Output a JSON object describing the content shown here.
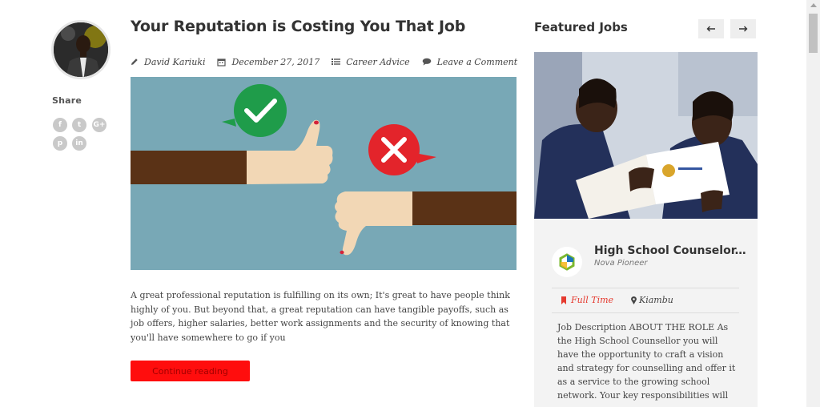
{
  "author_column": {
    "share_label": "Share",
    "social_icons": [
      {
        "name": "facebook-icon",
        "glyph": "f"
      },
      {
        "name": "twitter-icon",
        "glyph": "t"
      },
      {
        "name": "google-plus-icon",
        "glyph": "G+"
      },
      {
        "name": "pinterest-icon",
        "glyph": "p"
      },
      {
        "name": "linkedin-icon",
        "glyph": "in"
      }
    ]
  },
  "post": {
    "title": "Your Reputation is Costing You That Job",
    "author": "David Kariuki",
    "date": "December 27, 2017",
    "category": "Career Advice",
    "comments": "Leave a Comment",
    "excerpt": "A great professional reputation is fulfilling on its own; It's great to have people think highly of you. But beyond that, a great reputation can have tangible payoffs, such as job offers, higher salaries, better work assignments and the security of knowing that you'll have somewhere to go if you",
    "cta_label": "Continue reading"
  },
  "sidebar": {
    "title": "Featured Jobs",
    "prev_label": "←",
    "next_label": "→",
    "job": {
      "title": "High School Counselor...",
      "company": "Nova Pioneer",
      "type": "Full Time",
      "location": "Kiambu",
      "description": "Job Description ABOUT THE ROLE As the High School Counsellor you will have the opportunity to craft a vision and strategy for counselling and offer it as a service to the growing school network. Your key responsibilities will"
    }
  },
  "colors": {
    "accent_red": "#ff0d0d",
    "job_type_red": "#e53a2f",
    "hero_background": "#78a8b6",
    "check_green": "#1f9c4a",
    "cross_red": "#e3242b"
  }
}
